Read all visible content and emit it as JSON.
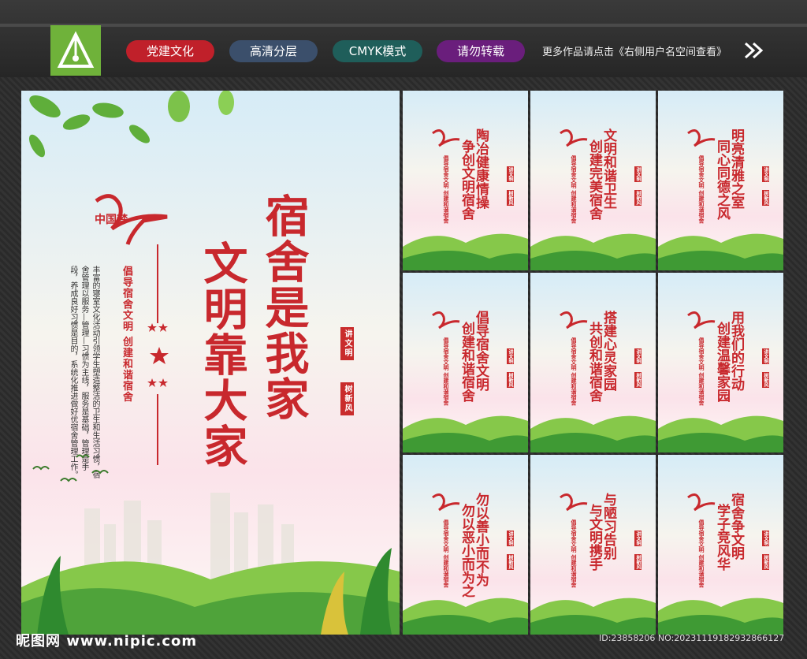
{
  "header": {
    "tags": [
      {
        "label": "党建文化",
        "color": "#c0202a"
      },
      {
        "label": "高清分层",
        "color": "#3b4f6b"
      },
      {
        "label": "CMYK模式",
        "color": "#1f5e5a"
      },
      {
        "label": "请勿转载",
        "color": "#6a1e7c"
      }
    ],
    "more_text": "更多作品请点击《右侧用户名空间查看》"
  },
  "main_poster": {
    "title_col1": "宿舍是我家",
    "title_col2": "文明靠大家",
    "seal_1": "讲文明",
    "seal_2": "树新风",
    "subtitle": "倡导宿舍文明  创建和谐宿舍",
    "body": "丰富的寝室文化活动引领学生塑造整洁的卫生和生活习惯，宿舍管理以服务—管理—习惯为主线，服务是基础，管理是手段，养成良好习惯是目的，系统化推进做好优宿舍管理工作。",
    "brand": "中国梦"
  },
  "small_posters": [
    {
      "line1": "陶冶健康情操",
      "line2": "争创文明宿舍"
    },
    {
      "line1": "文明和谐卫生",
      "line2": "创建完美宿舍"
    },
    {
      "line1": "明亮清雅之室",
      "line2": "同心同德之风"
    },
    {
      "line1": "倡导宿舍文明",
      "line2": "创建和谐宿舍"
    },
    {
      "line1": "搭建心灵家园",
      "line2": "共创和谐宿舍"
    },
    {
      "line1": "用我们的行动",
      "line2": "创建温馨家园"
    },
    {
      "line1": "勿以善小而不为",
      "line2": "勿以恶小而为之"
    },
    {
      "line1": "与陋习告别",
      "line2": "与文明携手"
    },
    {
      "line1": "宿舍争文明",
      "line2": "学子竞风华"
    }
  ],
  "small_caption": "倡导宿舍文明 创建和谐宿舍",
  "small_seal_1": "讲文明",
  "small_seal_2": "树新风",
  "footer": {
    "watermark": "昵图网 www.nipic.com",
    "id_line": "ID:23858206 NO:20231119182932866127"
  }
}
